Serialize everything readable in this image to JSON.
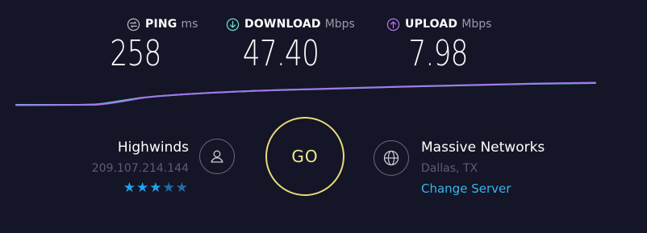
{
  "results": {
    "ping": {
      "label": "PING",
      "unit": "ms",
      "value": "258",
      "icon": "ping-icon",
      "color": "#b6b7c6"
    },
    "download": {
      "label": "DOWNLOAD",
      "unit": "Mbps",
      "value": "47.40",
      "icon": "download-arrow-icon",
      "color": "#6fe0d6"
    },
    "upload": {
      "label": "UPLOAD",
      "unit": "Mbps",
      "value": "7.98",
      "icon": "upload-arrow-icon",
      "color": "#bc72f2"
    }
  },
  "graph": {
    "download_color": "#5ed1c9",
    "upload_color": "#a770ef"
  },
  "host": {
    "name": "Highwinds",
    "ip": "209.107.214.144",
    "rating": 3,
    "rating_max": 5,
    "icon": "user-icon"
  },
  "go_button": {
    "label": "GO",
    "color": "#e9db7a"
  },
  "server": {
    "name": "Massive Networks",
    "location": "Dallas, TX",
    "change_label": "Change Server",
    "icon": "globe-icon"
  }
}
